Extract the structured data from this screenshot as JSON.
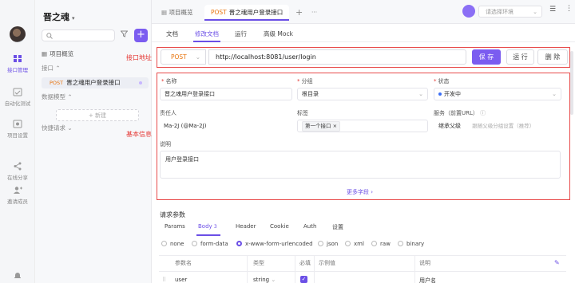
{
  "rail": {
    "items": [
      {
        "label": "接口管理",
        "icon": "api-icon"
      },
      {
        "label": "自动化测试",
        "icon": "test-icon"
      },
      {
        "label": "项目设置",
        "icon": "settings-icon"
      },
      {
        "label": "在线分享",
        "icon": "share-icon"
      },
      {
        "label": "邀请成员",
        "icon": "invite-icon"
      }
    ]
  },
  "sidebar": {
    "project_name": "晋之魂",
    "overview": "项目概览",
    "interfaces": "接口",
    "api_method": "POST",
    "api_name": "晋之魂用户登录接口",
    "data_model": "数据模型",
    "new_label": "+ 新建",
    "quick_request": "快捷请求"
  },
  "tabs": {
    "overview": "项目概览",
    "active_method": "POST",
    "active_name": "晋之魂用户登录接口",
    "add": "+",
    "more": "···",
    "env_placeholder": "请选择环境"
  },
  "subtabs": [
    "文档",
    "修改文档",
    "运行",
    "高级 Mock"
  ],
  "annotations": {
    "url": "接口地址",
    "basic": "基本信息"
  },
  "request": {
    "method": "POST",
    "url": "http://localhost:8081/user/login",
    "save": "保 存",
    "run": "运 行",
    "delete": "删 除"
  },
  "form": {
    "name_label": "名称",
    "name_value": "晋之魂用户登录接口",
    "group_label": "分组",
    "group_value": "根目录",
    "status_label": "状态",
    "status_value": "开发中",
    "owner_label": "责任人",
    "owner_value": "Ma-2J (@Ma-2J)",
    "tags_label": "标签",
    "tag_value": "第一个接口",
    "service_label": "服务（前置URL）",
    "service_value": "继承父级",
    "service_hint": "跟随父级分组设置（推荐）",
    "desc_label": "说明",
    "desc_value": "用户登录接口",
    "more_fields": "更多字段 ›"
  },
  "params": {
    "title": "请求参数",
    "tabs": [
      "Params",
      "Body",
      "Header",
      "Cookie",
      "Auth",
      "设置"
    ],
    "body_count": "3",
    "body_types": [
      "none",
      "form-data",
      "x-www-form-urlencoded",
      "json",
      "xml",
      "raw",
      "binary"
    ],
    "selected_body_type": "x-www-form-urlencoded",
    "columns": [
      "参数名",
      "类型",
      "必填",
      "示例值",
      "说明"
    ],
    "rows": [
      {
        "name": "user",
        "type": "string",
        "required": true,
        "example": "",
        "desc": "用户名"
      }
    ]
  },
  "colors": {
    "accent": "#7b5cf0",
    "post": "#e8730c",
    "annotation": "#e53935"
  }
}
